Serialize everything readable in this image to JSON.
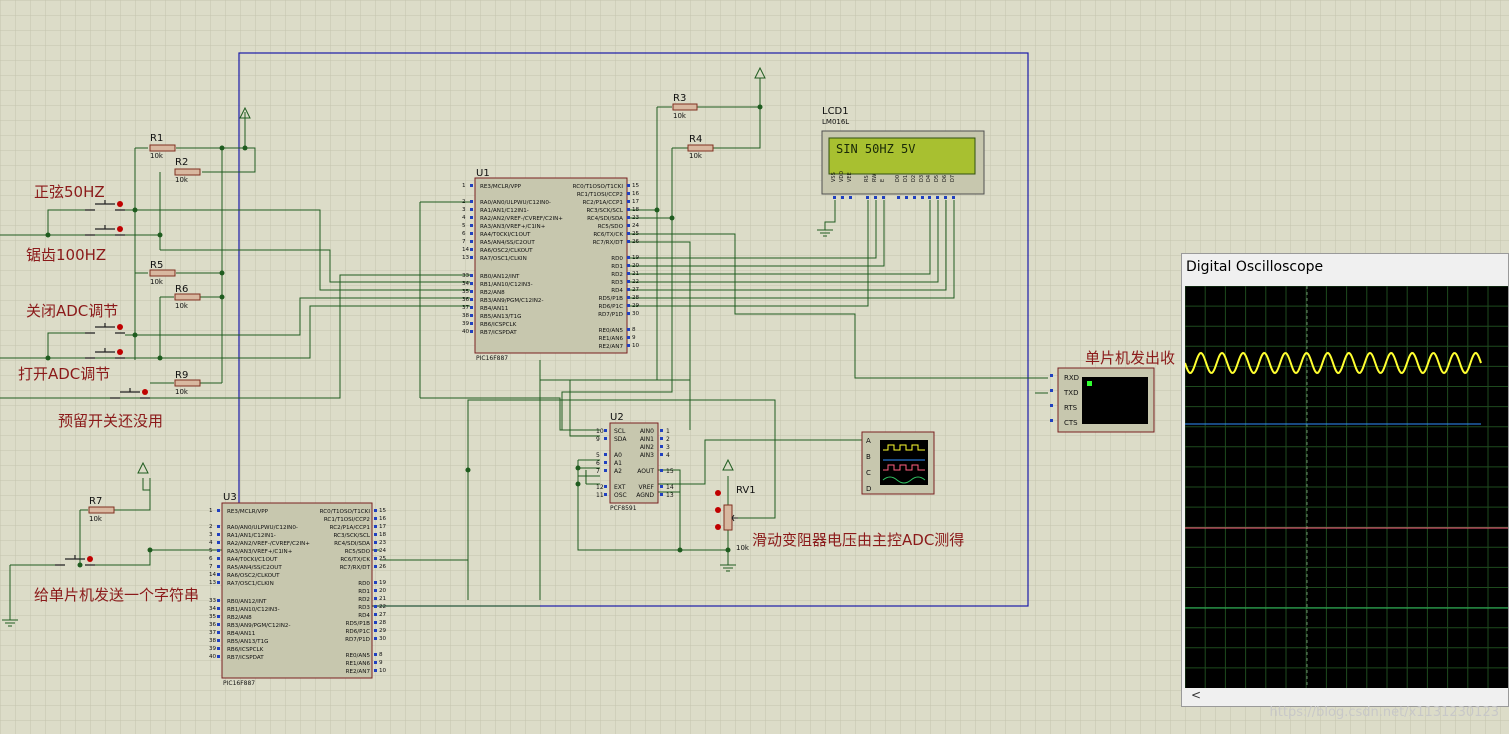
{
  "schematic": {
    "labels": {
      "sine_50hz": "正弦50HZ",
      "saw_100hz": "锯齿100HZ",
      "close_adc": "关闭ADC调节",
      "open_adc": "打开ADC调节",
      "reserved_switch": "预留开关还没用",
      "send_string": "给单片机发送一个字符串",
      "mcu_send_receive": "单片机发出收",
      "pot_note": "滑动变阻器电压由主控ADC测得"
    },
    "resistors": [
      {
        "ref": "R1",
        "value": "10k"
      },
      {
        "ref": "R2",
        "value": "10k"
      },
      {
        "ref": "R5",
        "value": "10k"
      },
      {
        "ref": "R6",
        "value": "10k"
      },
      {
        "ref": "R9",
        "value": "10k"
      },
      {
        "ref": "R3",
        "value": "10k"
      },
      {
        "ref": "R4",
        "value": "10k"
      },
      {
        "ref": "R7",
        "value": "10k"
      }
    ],
    "lcd": {
      "ref": "LCD1",
      "model": "LM016L",
      "text": "SIN 50HZ 5V",
      "pins": [
        "VSS",
        "VDD",
        "VEE",
        "RS",
        "RW",
        "E",
        "D0",
        "D1",
        "D2",
        "D3",
        "D4",
        "D5",
        "D6",
        "D7"
      ]
    },
    "u1": {
      "ref": "U1",
      "model": "PIC16F887",
      "left_pins": [
        "RE3/MCLR/VPP",
        "RA0/AN0/ULPWU/C12IN0-",
        "RA1/AN1/C12IN1-",
        "RA2/AN2/VREF-/CVREF/C2IN+",
        "RA3/AN3/VREF+/C1IN+",
        "RA4/T0CKI/C1OUT",
        "RA5/AN4/SS/C2OUT",
        "RA6/OSC2/CLKOUT",
        "RA7/OSC1/CLKIN",
        "RB0/AN12/INT",
        "RB1/AN10/C12IN3-",
        "RB2/AN8",
        "RB3/AN9/PGM/C12IN2-",
        "RB4/AN11",
        "RB5/AN13/T1G",
        "RB6/ICSPCLK",
        "RB7/ICSPDAT"
      ],
      "left_nums": [
        "1",
        "2",
        "3",
        "4",
        "5",
        "6",
        "7",
        "14",
        "13",
        "33",
        "34",
        "35",
        "36",
        "37",
        "38",
        "39",
        "40"
      ],
      "right_pins": [
        "RC0/T1OSO/T1CKI",
        "RC1/T1OSI/CCP2",
        "RC2/P1A/CCP1",
        "RC3/SCK/SCL",
        "RC4/SDI/SDA",
        "RC5/SDO",
        "RC6/TX/CK",
        "RC7/RX/DT",
        "RD0",
        "RD1",
        "RD2",
        "RD3",
        "RD4",
        "RD5/P1B",
        "RD6/P1C",
        "RD7/P1D",
        "RE0/AN5",
        "RE1/AN6",
        "RE2/AN7"
      ],
      "right_nums": [
        "15",
        "16",
        "17",
        "18",
        "23",
        "24",
        "25",
        "26",
        "19",
        "20",
        "21",
        "22",
        "27",
        "28",
        "29",
        "30",
        "8",
        "9",
        "10"
      ]
    },
    "u3": {
      "ref": "U3",
      "model": "PIC16F887"
    },
    "u2": {
      "ref": "U2",
      "model": "PCF8591",
      "left_pins": [
        "SCL",
        "SDA",
        "A0",
        "A1",
        "A2",
        "EXT",
        "OSC"
      ],
      "left_nums": [
        "10",
        "9",
        "5",
        "6",
        "7",
        "12",
        "11"
      ],
      "right_pins": [
        "AIN0",
        "AIN1",
        "AIN2",
        "AIN3",
        "AOUT",
        "VREF",
        "AGND"
      ],
      "right_nums": [
        "1",
        "2",
        "3",
        "4",
        "15",
        "14",
        "13"
      ]
    },
    "pot": {
      "ref": "RV1",
      "value": "10k"
    },
    "terminal": {
      "pins": [
        "RXD",
        "TXD",
        "RTS",
        "CTS"
      ]
    },
    "scope_probe": {
      "channels": [
        "A",
        "B",
        "C",
        "D"
      ]
    }
  },
  "oscilloscope": {
    "title": "Digital Oscilloscope",
    "scroll_arrow": "<",
    "colors": {
      "ch_a": "#ffff30",
      "ch_b": "#3090ff",
      "ch_c": "#ff6080",
      "ch_d": "#30c060"
    }
  },
  "watermark": "https://blog.csdn.net/x1131230123"
}
